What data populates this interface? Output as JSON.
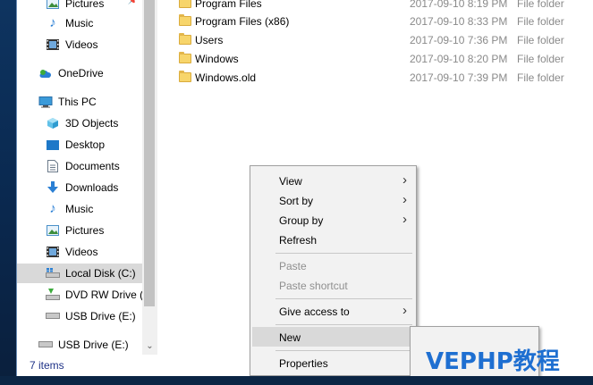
{
  "nav": {
    "items": [
      {
        "label": "Pictures",
        "icon": "pictures-icon",
        "pinned": true
      },
      {
        "label": "Music",
        "icon": "music-icon"
      },
      {
        "label": "Videos",
        "icon": "videos-icon"
      },
      {
        "label": "OneDrive",
        "icon": "onedrive-icon"
      },
      {
        "label": "This PC",
        "icon": "this-pc-icon"
      },
      {
        "label": "3D Objects",
        "icon": "3d-objects-icon"
      },
      {
        "label": "Desktop",
        "icon": "desktop-icon"
      },
      {
        "label": "Documents",
        "icon": "documents-icon"
      },
      {
        "label": "Downloads",
        "icon": "downloads-icon"
      },
      {
        "label": "Music",
        "icon": "music-icon"
      },
      {
        "label": "Pictures",
        "icon": "pictures-icon"
      },
      {
        "label": "Videos",
        "icon": "videos-icon"
      },
      {
        "label": "Local Disk (C:)",
        "icon": "local-disk-icon",
        "selected": true
      },
      {
        "label": "DVD RW Drive (D",
        "icon": "dvd-drive-icon"
      },
      {
        "label": "USB Drive (E:)",
        "icon": "usb-drive-icon"
      },
      {
        "label": "USB Drive (E:)",
        "icon": "usb-drive-icon"
      }
    ]
  },
  "status": {
    "item_count": "7 items"
  },
  "files": [
    {
      "name": "Program Files",
      "date": "2017-09-10 8:19 PM",
      "type": "File folder"
    },
    {
      "name": "Program Files (x86)",
      "date": "2017-09-10 8:33 PM",
      "type": "File folder"
    },
    {
      "name": "Users",
      "date": "2017-09-10 7:36 PM",
      "type": "File folder"
    },
    {
      "name": "Windows",
      "date": "2017-09-10 8:20 PM",
      "type": "File folder"
    },
    {
      "name": "Windows.old",
      "date": "2017-09-10 7:39 PM",
      "type": "File folder"
    }
  ],
  "context_menu": {
    "view": "View",
    "sort_by": "Sort by",
    "group_by": "Group by",
    "refresh": "Refresh",
    "paste": "Paste",
    "paste_shortcut": "Paste shortcut",
    "give_access_to": "Give access to",
    "new": "New",
    "properties": "Properties"
  },
  "watermark": "VEPHP教程",
  "colors": {
    "selection": "#d9d9d9",
    "status_text": "#1e3287",
    "folder": "#f7d56b",
    "watermark": "#1e6fd1"
  }
}
